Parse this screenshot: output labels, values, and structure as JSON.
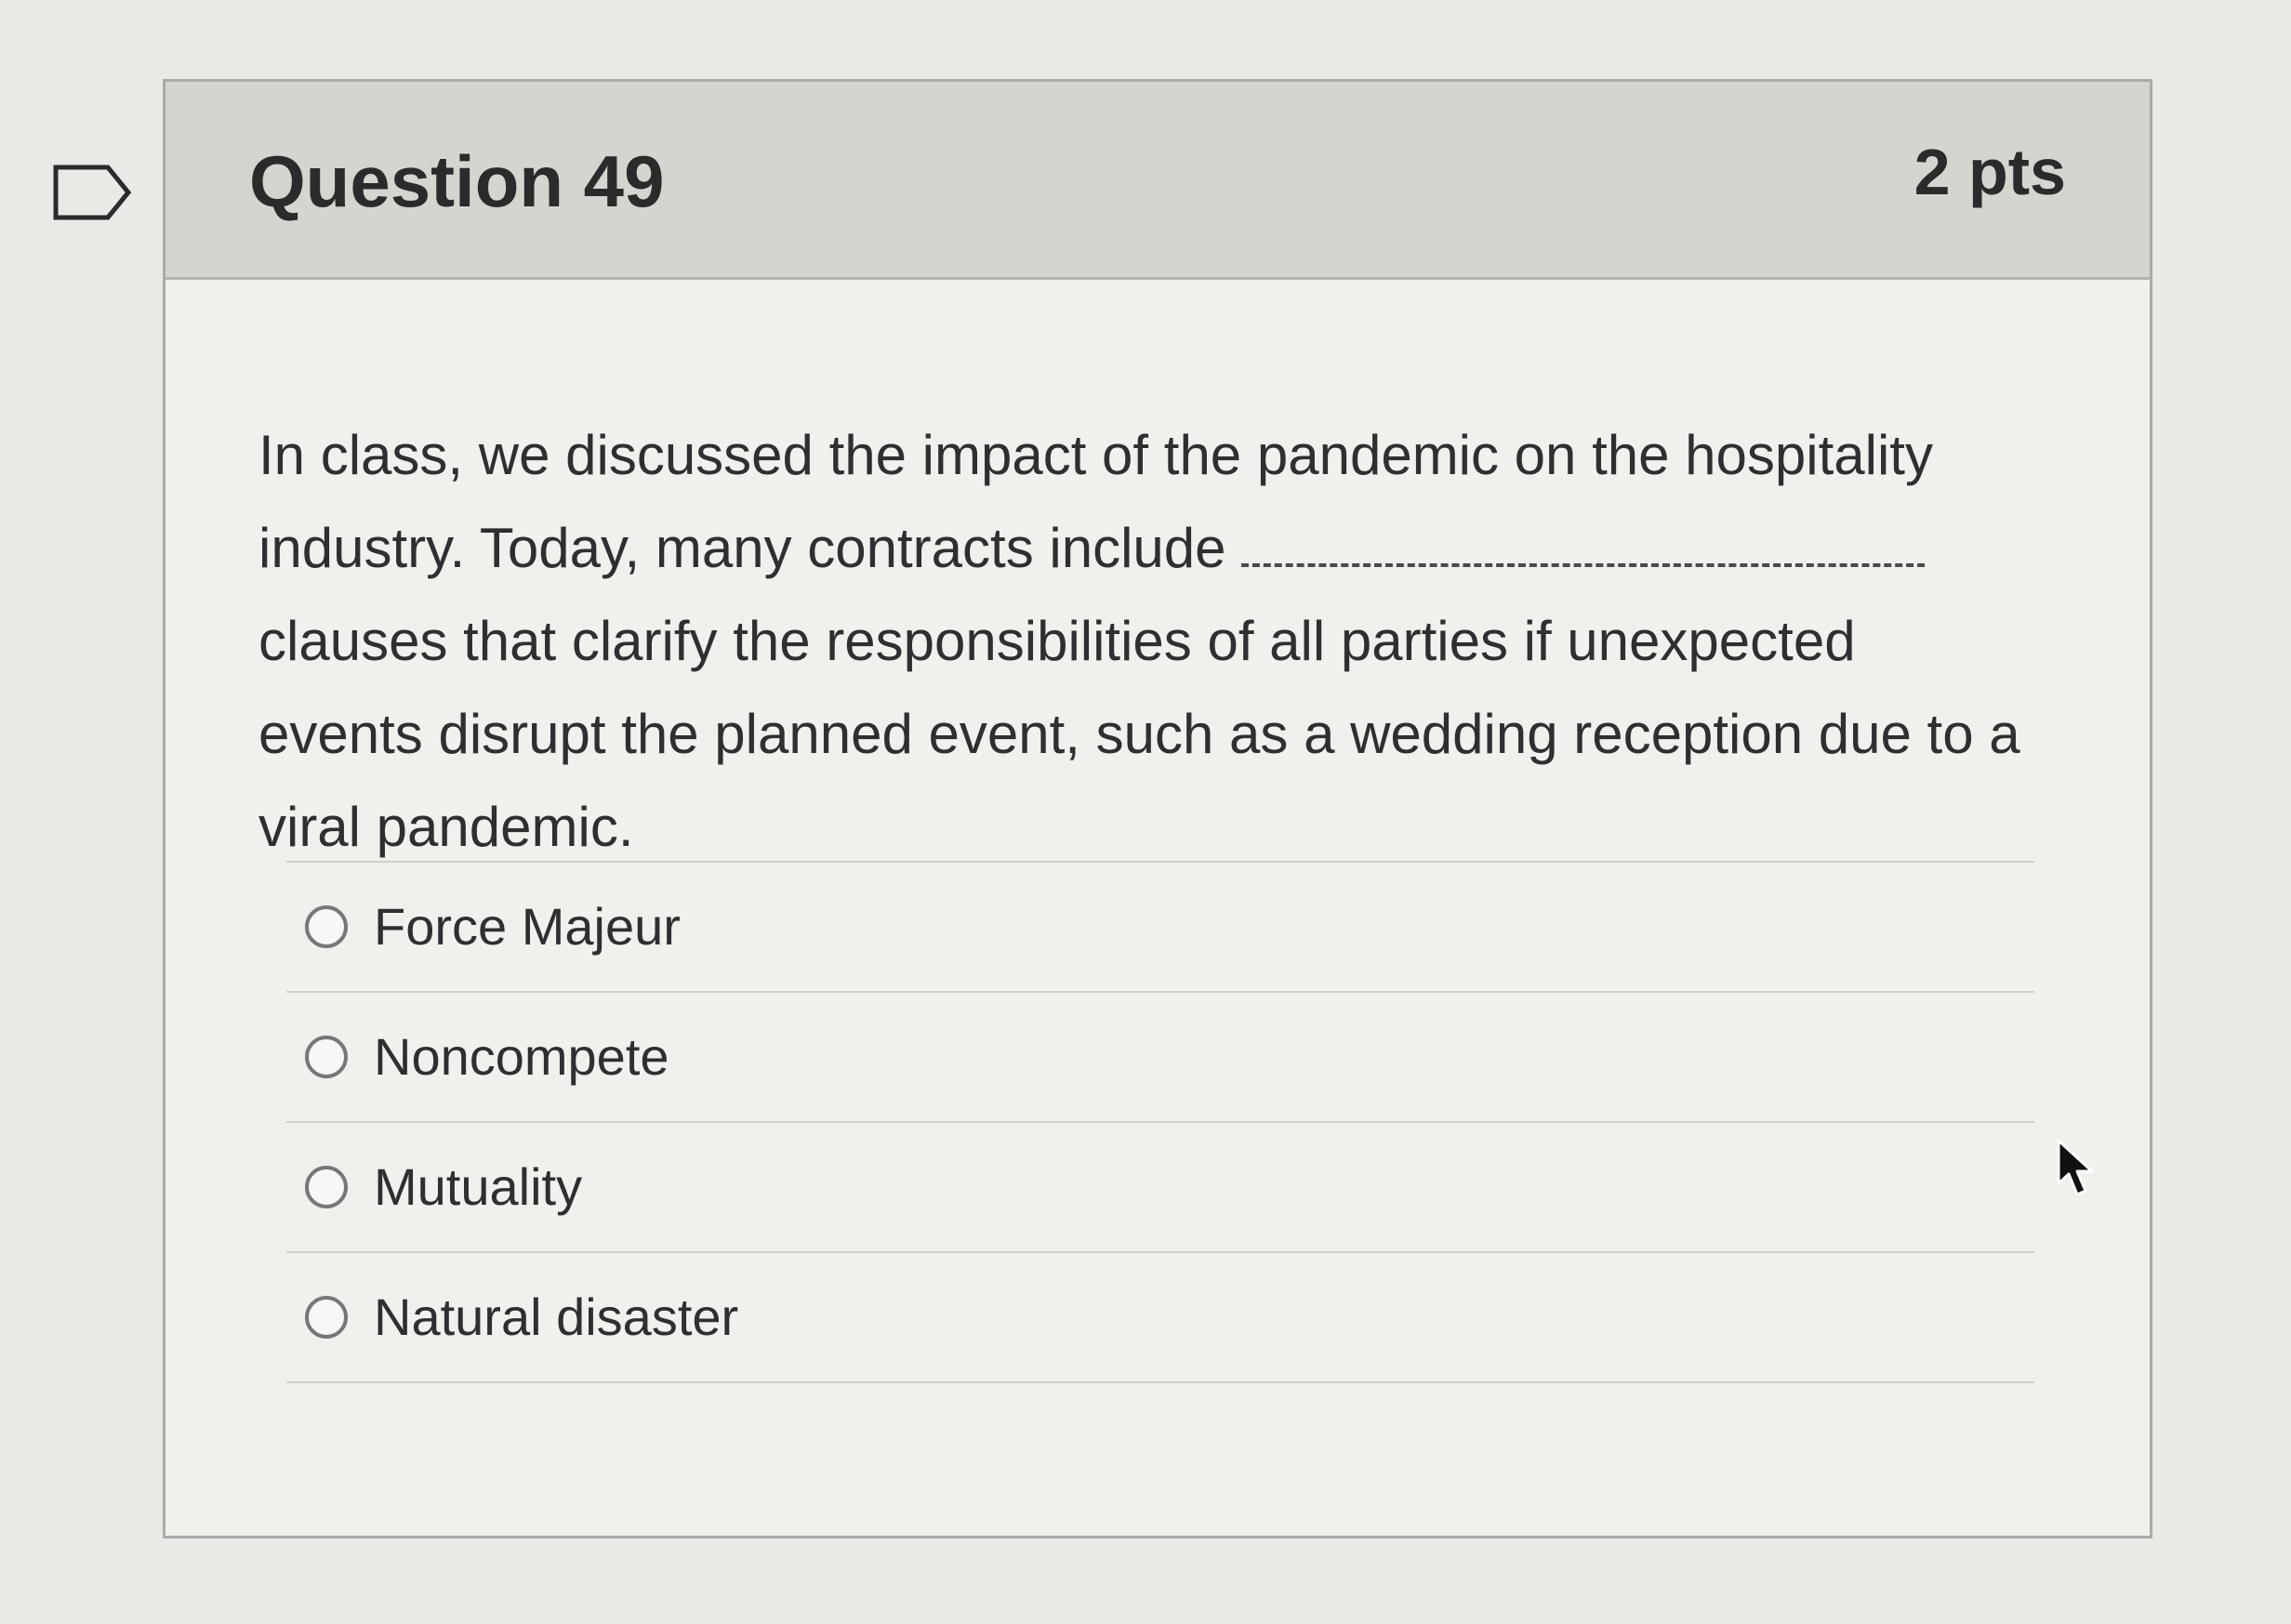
{
  "question": {
    "title": "Question 49",
    "points": "2 pts",
    "text_before_blank": "In class, we discussed the impact of the pandemic on the hospitality industry.  Today, many contracts include ",
    "text_after_blank": "clauses that clarify the responsibilities of all parties if unexpected events disrupt the planned event, such as a wedding reception due to a viral pandemic."
  },
  "answers": [
    {
      "label": "Force Majeur",
      "selected": false
    },
    {
      "label": "Noncompete",
      "selected": false
    },
    {
      "label": "Mutuality",
      "selected": false
    },
    {
      "label": "Natural disaster",
      "selected": false
    }
  ],
  "icons": {
    "bookmark": "bookmark-flag-icon",
    "radio": "radio-unchecked-icon",
    "cursor": "mouse-pointer-icon"
  },
  "colors": {
    "header_background": "#d6d4cf",
    "card_background": "#f0f0ed",
    "text": "#2f2f2f",
    "border": "#a9aca8"
  }
}
